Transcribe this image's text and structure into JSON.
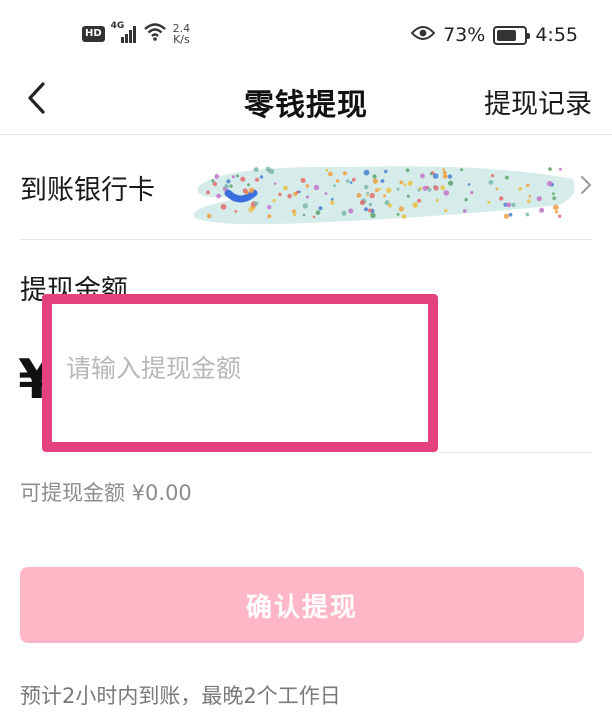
{
  "status_bar": {
    "hd": "HD",
    "network": "4G",
    "speed_value": "2.4",
    "speed_unit": "K/s",
    "battery_percent": "73%",
    "battery_level": 0.73,
    "time": "4:55"
  },
  "nav": {
    "title": "零钱提现",
    "right_link": "提现记录"
  },
  "bank": {
    "label": "到账银行卡"
  },
  "amount": {
    "label": "提现金额",
    "currency": "¥",
    "placeholder": "请输入提现金额",
    "value": ""
  },
  "available": {
    "text": "可提现金额 ¥0.00"
  },
  "confirm": {
    "label": "确认提现"
  },
  "note": {
    "text": "预计2小时内到账，最晚2个工作日"
  },
  "colors": {
    "highlight_border": "#e4417f",
    "button_disabled": "#ffb6c6",
    "mask_base": "#d6ecea"
  }
}
